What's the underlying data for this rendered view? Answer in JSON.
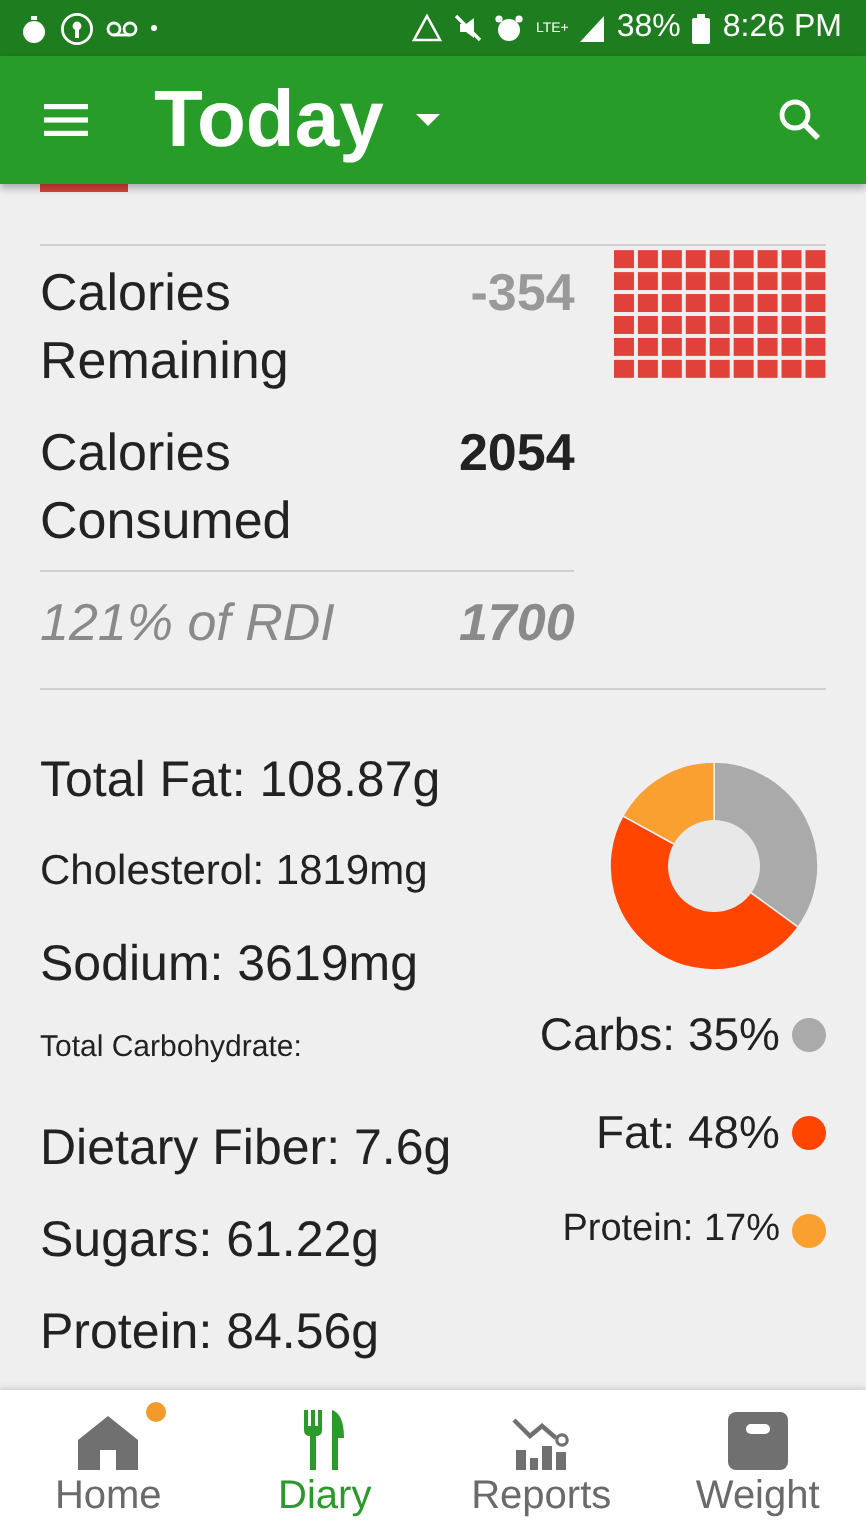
{
  "status_bar": {
    "network": "LTE+",
    "battery": "38%",
    "time": "8:26 PM"
  },
  "app_bar": {
    "title": "Today"
  },
  "summary": {
    "rows": [
      {
        "label": "Calories Remaining",
        "value": "-354",
        "kind": "muted"
      },
      {
        "label": "Calories Consumed",
        "value": "2054",
        "kind": "bold"
      },
      {
        "label": "121% of RDI",
        "value": "1700",
        "kind": "italic"
      }
    ]
  },
  "nutrients": [
    {
      "text": "Total Fat: 108.87g",
      "kind": "large"
    },
    {
      "text": "Cholesterol: 1819mg",
      "kind": "medium"
    },
    {
      "text": "Sodium: 3619mg",
      "kind": "large"
    },
    {
      "text": "Total Carbohydrate:",
      "kind": "small"
    },
    {
      "text": "Dietary Fiber: 7.6g",
      "kind": "large"
    },
    {
      "text": "Sugars: 61.22g",
      "kind": "large"
    },
    {
      "text": "Protein: 84.56g",
      "kind": "large"
    }
  ],
  "macros": {
    "chart_data": {
      "type": "donut",
      "categories": [
        "Carbs: 35%",
        "Fat: 48%",
        "Protein: 17%"
      ],
      "series": [
        {
          "values": [
            35,
            48,
            17
          ]
        }
      ]
    },
    "legend": [
      {
        "color": "#aaaaaa",
        "kind": "large"
      },
      {
        "color": "#ff4500",
        "kind": "large"
      },
      {
        "color": "#f9a031",
        "kind": "small"
      }
    ]
  },
  "nav": [
    {
      "label": "Home",
      "selected": false,
      "badge": true
    },
    {
      "label": "Diary",
      "selected": true,
      "badge": false
    },
    {
      "label": "Reports",
      "selected": false,
      "badge": false
    },
    {
      "label": "Weight",
      "selected": false,
      "badge": false
    }
  ]
}
